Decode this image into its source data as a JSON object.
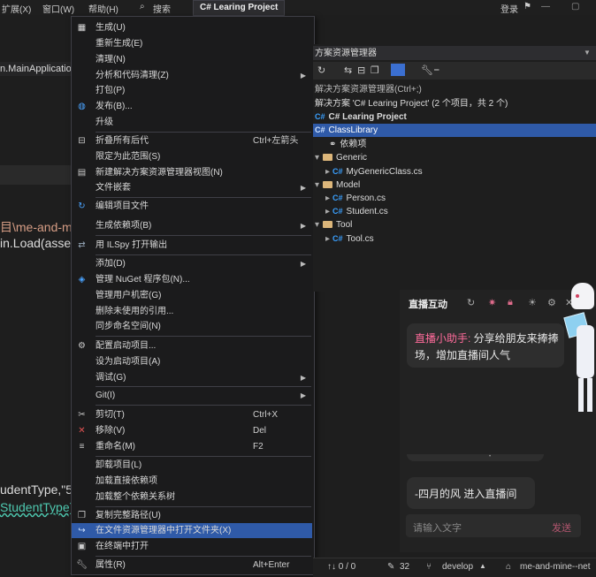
{
  "titlebar": {
    "menus": [
      "扩展(X)",
      "窗口(W)",
      "帮助(H)",
      "搜索"
    ],
    "project_title": "C# Learing Project",
    "login": "登录"
  },
  "editor": {
    "line1": "n.MainApplication",
    "line2": "目\\me-and-m",
    "line3": "in.Load(asse",
    "line4": "udentType,\"5",
    "line5": "StudentType)"
  },
  "context_menu": {
    "items": [
      {
        "label": "生成(U)",
        "shortcut": "",
        "arrow": false
      },
      {
        "label": "重新生成(E)",
        "shortcut": "",
        "arrow": false
      },
      {
        "label": "清理(N)",
        "shortcut": "",
        "arrow": false
      },
      {
        "label": "分析和代码清理(Z)",
        "shortcut": "",
        "arrow": true
      },
      {
        "label": "打包(P)",
        "shortcut": "",
        "arrow": false
      },
      {
        "label": "发布(B)...",
        "shortcut": "",
        "arrow": false
      },
      {
        "label": "升级",
        "shortcut": "",
        "arrow": false
      },
      {
        "label": "折叠所有后代",
        "shortcut": "Ctrl+左箭头",
        "arrow": false
      },
      {
        "label": "限定为此范围(S)",
        "shortcut": "",
        "arrow": false
      },
      {
        "label": "新建解决方案资源管理器视图(N)",
        "shortcut": "",
        "arrow": false
      },
      {
        "label": "文件嵌套",
        "shortcut": "",
        "arrow": true
      },
      {
        "label": "编辑项目文件",
        "shortcut": "",
        "arrow": false
      },
      {
        "label": "生成依赖项(B)",
        "shortcut": "",
        "arrow": true
      },
      {
        "label": "用 ILSpy 打开输出",
        "shortcut": "",
        "arrow": false
      },
      {
        "label": "添加(D)",
        "shortcut": "",
        "arrow": true
      },
      {
        "label": "管理 NuGet 程序包(N)...",
        "shortcut": "",
        "arrow": false
      },
      {
        "label": "管理用户机密(G)",
        "shortcut": "",
        "arrow": false
      },
      {
        "label": "删除未使用的引用...",
        "shortcut": "",
        "arrow": false
      },
      {
        "label": "同步命名空间(N)",
        "shortcut": "",
        "arrow": false
      },
      {
        "label": "配置启动项目...",
        "shortcut": "",
        "arrow": false
      },
      {
        "label": "设为启动项目(A)",
        "shortcut": "",
        "arrow": false
      },
      {
        "label": "调试(G)",
        "shortcut": "",
        "arrow": true
      },
      {
        "label": "Git(I)",
        "shortcut": "",
        "arrow": true
      },
      {
        "label": "剪切(T)",
        "shortcut": "Ctrl+X",
        "arrow": false
      },
      {
        "label": "移除(V)",
        "shortcut": "Del",
        "arrow": false
      },
      {
        "label": "重命名(M)",
        "shortcut": "F2",
        "arrow": false
      },
      {
        "label": "卸载项目(L)",
        "shortcut": "",
        "arrow": false
      },
      {
        "label": "加载直接依赖项",
        "shortcut": "",
        "arrow": false
      },
      {
        "label": "加载整个依赖关系树",
        "shortcut": "",
        "arrow": false
      },
      {
        "label": "复制完整路径(U)",
        "shortcut": "",
        "arrow": false
      },
      {
        "label": "在文件资源管理器中打开文件夹(X)",
        "shortcut": "",
        "arrow": false
      },
      {
        "label": "在终端中打开",
        "shortcut": "",
        "arrow": false
      },
      {
        "label": "属性(R)",
        "shortcut": "Alt+Enter",
        "arrow": false
      }
    ],
    "selected_index": 30
  },
  "solution_explorer": {
    "title": "方案资源管理器",
    "search_placeholder": "解决方案资源管理器(Ctrl+;)",
    "solution": "解决方案 'C# Learing Project' (2 个项目，共 2 个)",
    "project": "C# Learing Project",
    "class_library": "ClassLibrary",
    "deps": "依赖项",
    "folders": {
      "generic": "Generic",
      "generic_file": "MyGenericClass.cs",
      "model": "Model",
      "person": "Person.cs",
      "student": "Student.cs",
      "tool": "Tool",
      "tool_file": "Tool.cs"
    }
  },
  "live_panel": {
    "title": "直播互动",
    "helper_name": "直播小助手:",
    "helper_msg": " 分享给朋友来捧捧场，增加直播间人气",
    "join_msg": "-四月的风 进入直播间",
    "input_placeholder": "请输入文字",
    "send_label": "发送"
  },
  "status_bar": {
    "sync": "↑↓ 0 / 0",
    "edits": "32",
    "branch": "develop",
    "repo": "me-and-mine--net"
  },
  "colors": {
    "accent": "#2f5aa8",
    "selected_tree": "#2f5aa8",
    "pink": "#ff6b9b"
  }
}
